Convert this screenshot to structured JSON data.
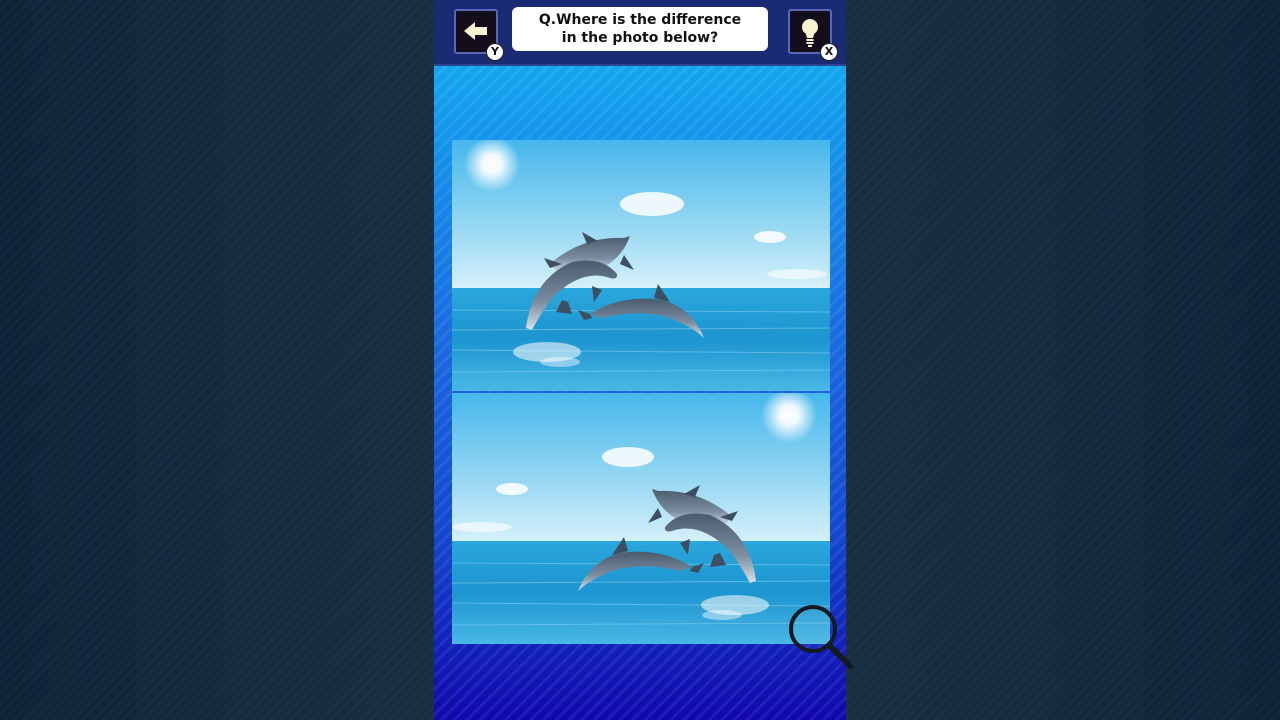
{
  "header": {
    "question_line1": "Q.Where is the difference",
    "question_line2": "in the photo below?",
    "back_key": "Y",
    "hint_key": "X"
  },
  "icons": {
    "back": "arrow-left-icon",
    "hint": "lightbulb-icon",
    "magnifier": "magnifier-icon"
  },
  "colors": {
    "topbar": "#1b2b73",
    "sky": "#7fd2f3",
    "sea": "#1d9bd6"
  }
}
